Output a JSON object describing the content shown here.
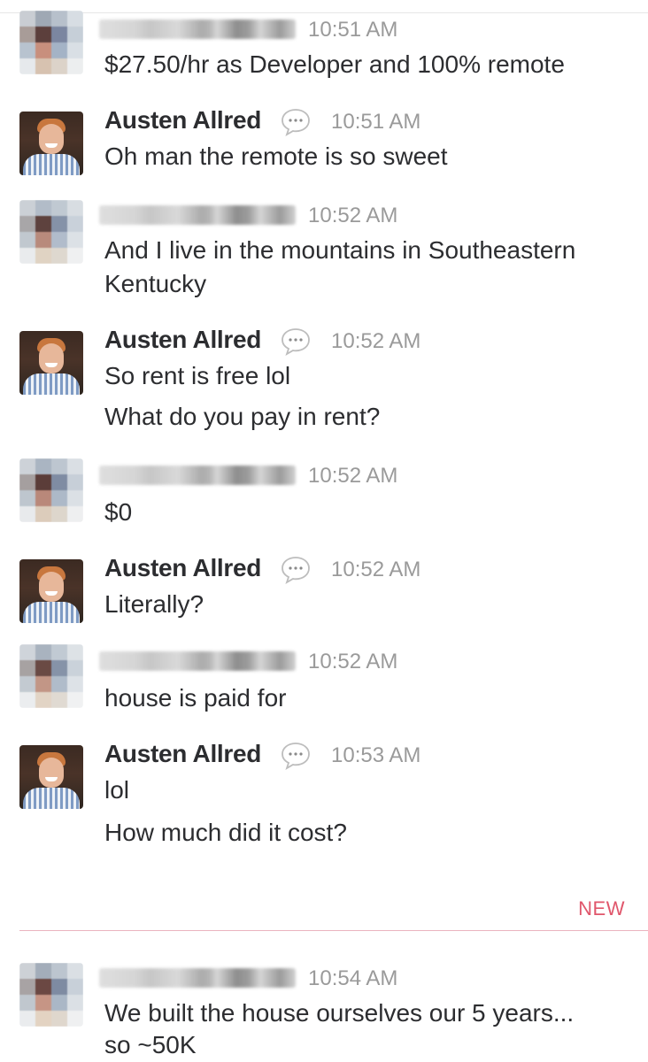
{
  "messages": [
    {
      "type": "other",
      "time": "10:51 AM",
      "lines": [
        "$27.50/hr as Developer and 100% remote"
      ]
    },
    {
      "type": "austen",
      "name": "Austen Allred",
      "time": "10:51 AM",
      "lines": [
        "Oh man the remote is so sweet"
      ]
    },
    {
      "type": "other",
      "time": "10:52 AM",
      "lines": [
        "And I live in the mountains in Southeastern",
        "Kentucky"
      ]
    },
    {
      "type": "austen",
      "name": "Austen Allred",
      "time": "10:52 AM",
      "lines": [
        "So rent is free lol",
        "What do you pay in rent?"
      ]
    },
    {
      "type": "other",
      "time": "10:52 AM",
      "lines": [
        "$0"
      ]
    },
    {
      "type": "austen",
      "name": "Austen Allred",
      "time": "10:52 AM",
      "lines": [
        "Literally?"
      ]
    },
    {
      "type": "other",
      "time": "10:52 AM",
      "lines": [
        "house is paid for"
      ]
    },
    {
      "type": "austen",
      "name": "Austen Allred",
      "time": "10:53 AM",
      "lines": [
        "lol",
        "How much did it cost?"
      ]
    },
    {
      "type": "other",
      "time": "10:54 AM",
      "lines": [
        "We built the house ourselves our 5 years...",
        "so ~50K"
      ]
    }
  ],
  "new_divider": {
    "label": "NEW",
    "color": "#e0566b"
  },
  "colors": {
    "text": "#2c2d30",
    "timestamp": "#9a9a9a",
    "new_line": "#ebb4bf"
  },
  "icons": {
    "status": "speech-bubble-icon"
  }
}
